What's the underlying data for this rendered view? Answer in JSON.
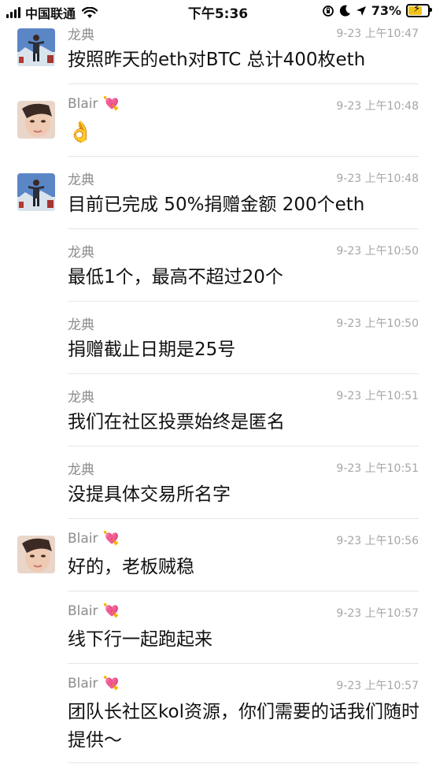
{
  "status_bar": {
    "carrier": "中国联通",
    "time": "下午5:36",
    "battery": "73%",
    "battery_level": 0.73
  },
  "messages": [
    {
      "sender": "龙典",
      "time": "9-23 上午10:47",
      "text": "按照昨天的eth对BTC 总计400枚eth",
      "avatar": "mountain-person"
    },
    {
      "sender": "Blair",
      "time": "9-23 上午10:48",
      "text": "👌",
      "avatar": "face-portrait",
      "badge": "💘"
    },
    {
      "sender": "龙典",
      "time": "9-23 上午10:48",
      "text": "目前已完成 50%捐赠金额 200个eth",
      "avatar": "mountain-person"
    },
    {
      "sender": "龙典",
      "time": "9-23 上午10:50",
      "text": "最低1个，最高不超过20个"
    },
    {
      "sender": "龙典",
      "time": "9-23 上午10:50",
      "text": "捐赠截止日期是25号"
    },
    {
      "sender": "龙典",
      "time": "9-23 上午10:51",
      "text": "我们在社区投票始终是匿名"
    },
    {
      "sender": "龙典",
      "time": "9-23 上午10:51",
      "text": "没提具体交易所名字"
    },
    {
      "sender": "Blair",
      "time": "9-23 上午10:56",
      "text": "好的，老板贼稳",
      "avatar": "face-portrait",
      "badge": "💘"
    },
    {
      "sender": "Blair",
      "time": "9-23 上午10:57",
      "text": "线下行一起跑起来",
      "badge": "💘"
    },
    {
      "sender": "Blair",
      "time": "9-23 上午10:57",
      "text": "团队长社区kol资源，你们需要的话我们随时提供～",
      "badge": "💘"
    }
  ]
}
